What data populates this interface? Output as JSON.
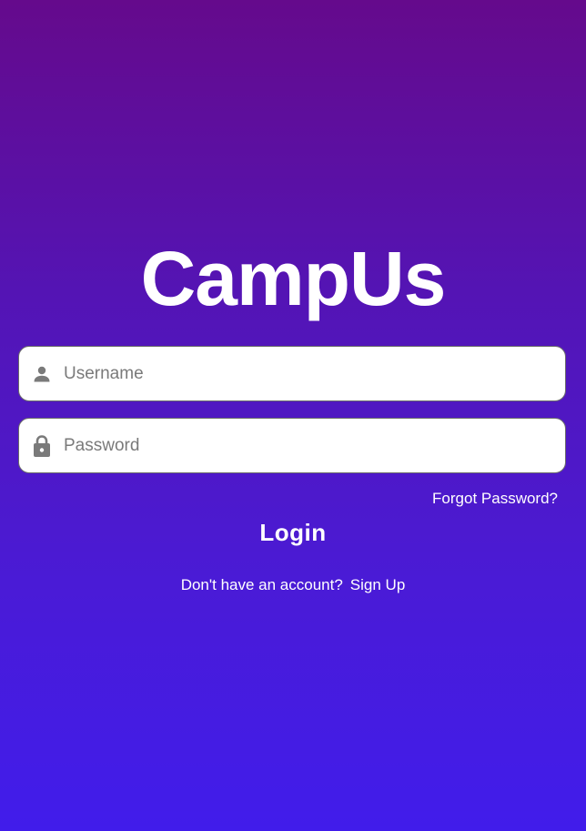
{
  "app": {
    "title": "CampUs"
  },
  "login_form": {
    "username": {
      "placeholder": "Username",
      "value": "",
      "icon": "person-icon"
    },
    "password": {
      "placeholder": "Password",
      "value": "",
      "icon": "lock-icon"
    },
    "forgot_password_label": "Forgot Password?",
    "login_label": "Login"
  },
  "signup": {
    "prompt": "Don't have an account?",
    "link_label": "Sign Up"
  },
  "colors": {
    "gradient_top": "#650a8c",
    "gradient_bottom": "#411ceb",
    "field_background": "#ffffff",
    "icon_gray": "#7a7a7a",
    "text_white": "#ffffff"
  }
}
